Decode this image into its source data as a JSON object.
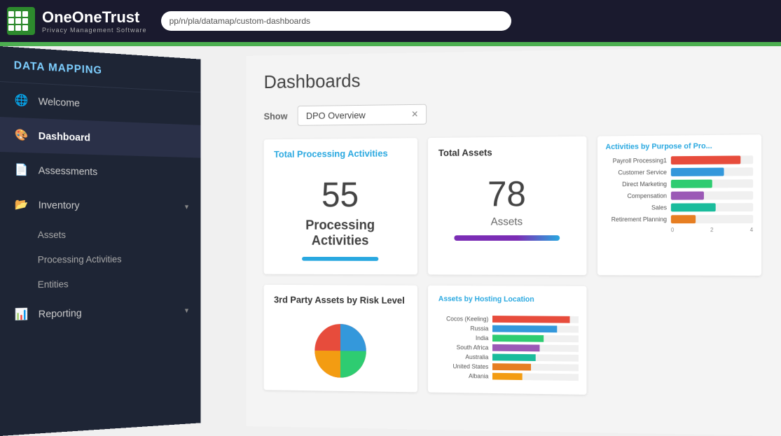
{
  "topbar": {
    "logo_brand": "OneTrust",
    "logo_sub": "Privacy Management Software",
    "address": "pp/n/pla/datamap/custom-dashboards"
  },
  "sidebar": {
    "header": "DATA MAPPING",
    "items": [
      {
        "id": "welcome",
        "label": "Welcome",
        "icon": "globe",
        "active": false
      },
      {
        "id": "dashboard",
        "label": "Dashboard",
        "icon": "palette",
        "active": true
      },
      {
        "id": "assessments",
        "label": "Assessments",
        "icon": "document",
        "active": false
      },
      {
        "id": "inventory",
        "label": "Inventory",
        "icon": "folder",
        "active": false,
        "has_chevron": true
      },
      {
        "id": "assets",
        "label": "Assets",
        "sub": true
      },
      {
        "id": "processing-activities",
        "label": "Processing Activities",
        "sub": true
      },
      {
        "id": "entities",
        "label": "Entities",
        "sub": true
      },
      {
        "id": "reporting",
        "label": "Reporting",
        "icon": "chart",
        "has_chevron": true
      }
    ]
  },
  "content": {
    "page_title": "Dashboards",
    "show_label": "Show",
    "dashboard_select": "DPO Overview",
    "cards": {
      "processing_activities": {
        "title": "Total Processing Activities",
        "number": "55",
        "label_line1": "Processing",
        "label_line2": "Activities"
      },
      "total_assets": {
        "title": "Total Assets",
        "number": "78",
        "label": "Assets"
      },
      "activities_by_purpose": {
        "title": "Activities by Purpose of Pro...",
        "items": [
          {
            "label": "Payroll Processing1",
            "value": 85,
            "color": "#e74c3c"
          },
          {
            "label": "Customer Service",
            "value": 65,
            "color": "#3498db"
          },
          {
            "label": "Direct Marketing",
            "value": 50,
            "color": "#2ecc71"
          },
          {
            "label": "Compensation",
            "value": 40,
            "color": "#9b59b6"
          },
          {
            "label": "Sales",
            "value": 55,
            "color": "#1abc9c"
          },
          {
            "label": "Retirement Planning",
            "value": 30,
            "color": "#e67e22"
          }
        ],
        "axis": [
          "0",
          "2",
          "4"
        ]
      },
      "third_party_assets": {
        "title": "3rd Party Assets by Risk Level"
      },
      "assets_hosting": {
        "title": "Assets by Hosting Location",
        "items": [
          {
            "label": "Cocos (Keeling)",
            "value": 90,
            "color": "#e74c3c"
          },
          {
            "label": "Russia",
            "value": 75,
            "color": "#3498db"
          },
          {
            "label": "India",
            "value": 60,
            "color": "#2ecc71"
          },
          {
            "label": "South Africa",
            "value": 55,
            "color": "#9b59b6"
          },
          {
            "label": "Australia",
            "value": 50,
            "color": "#1abc9c"
          },
          {
            "label": "United States",
            "value": 45,
            "color": "#e67e22"
          },
          {
            "label": "Albania",
            "value": 35,
            "color": "#f39c12"
          }
        ]
      }
    }
  }
}
